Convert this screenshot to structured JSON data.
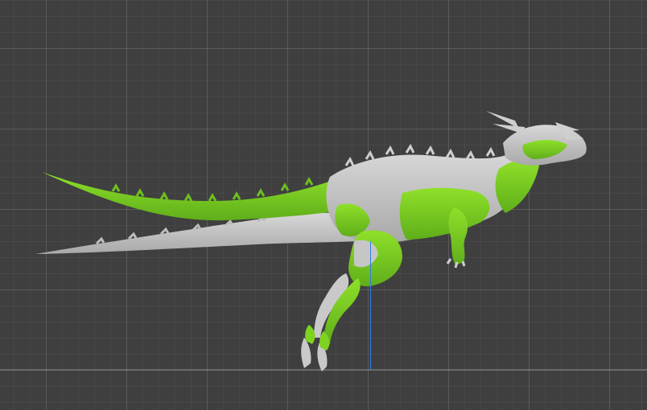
{
  "scene": {
    "object": "dinosaur-model",
    "colors": {
      "viewport_bg": "#3f3f3f",
      "mesh_gray": "#c9c9c9",
      "mesh_shadow": "#9a9a9a",
      "paint_green": "#7ed321",
      "axis_blue": "#2f7de9"
    },
    "icons": [
      "z-axis-line"
    ]
  }
}
